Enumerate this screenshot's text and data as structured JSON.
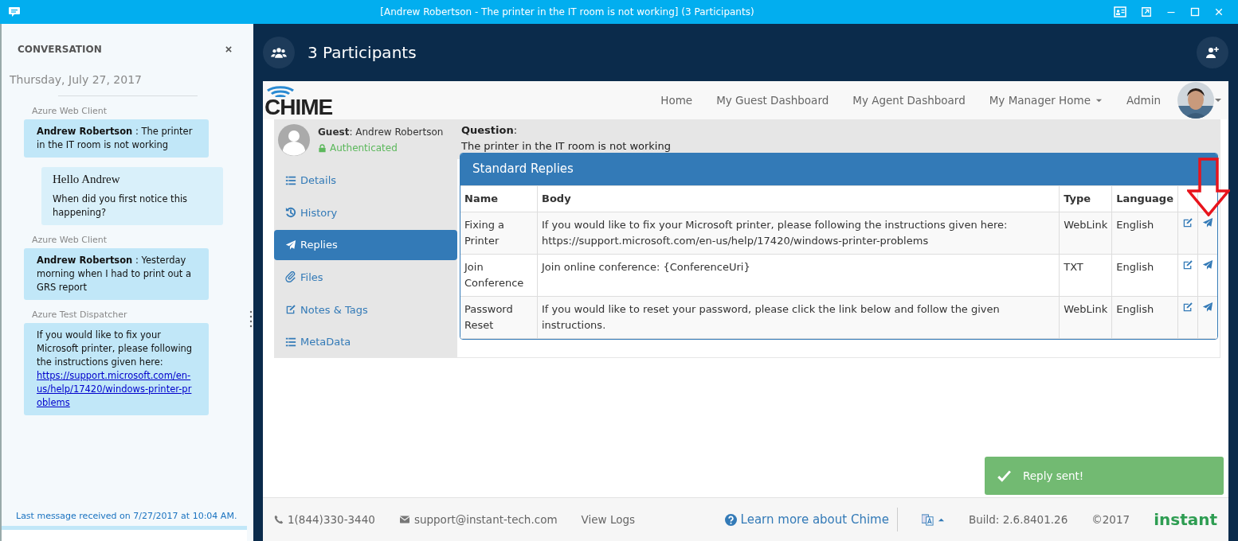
{
  "window": {
    "title": "[Andrew Robertson - The printer in the IT room is not working] (3 Participants)"
  },
  "conversation": {
    "heading": "CONVERSATION",
    "date": "Thursday, July 27, 2017",
    "messages": [
      {
        "kind": "incoming",
        "sender": "Azure Web Client",
        "text": "**Andrew Robertson** : The printer in the IT room is not working"
      },
      {
        "kind": "outgoing",
        "greeting": "Hello Andrew",
        "text": "When did you first notice this happening?"
      },
      {
        "kind": "incoming",
        "sender": "Azure Web Client",
        "text": "**Andrew Robertson** : Yesterday morning when I had to print out a GRS report"
      },
      {
        "kind": "incoming",
        "sender": "Azure Test Dispatcher",
        "text": "If you would like to fix your Microsoft printer, please following the instructions given here:",
        "link": "https://support.microsoft.com/en-us/help/17420/windows-printer-problems"
      }
    ],
    "status": "Last message received on 7/27/2017 at 10:04 AM."
  },
  "header": {
    "title": "3 Participants"
  },
  "navbar": {
    "logo": "CHIME",
    "items": [
      {
        "label": "Home",
        "dropdown": false
      },
      {
        "label": "My Guest Dashboard",
        "dropdown": false
      },
      {
        "label": "My Agent Dashboard",
        "dropdown": false
      },
      {
        "label": "My Manager Home",
        "dropdown": true
      },
      {
        "label": "Admin",
        "dropdown": false
      }
    ]
  },
  "guest": {
    "name": "**Guest**: Andrew Robertson",
    "status": "Authenticated"
  },
  "question": {
    "label": "**Question**:",
    "text": "The printer in the IT room is not working"
  },
  "sidebar": {
    "items": [
      {
        "label": "Details",
        "selected": false
      },
      {
        "label": "History",
        "selected": false
      },
      {
        "label": "Replies",
        "selected": true
      },
      {
        "label": "Files",
        "selected": false
      },
      {
        "label": "Notes & Tags",
        "selected": false
      },
      {
        "label": "MetaData",
        "selected": false
      }
    ]
  },
  "replies": {
    "title": "Standard Replies",
    "columns": [
      "Name",
      "Body",
      "Type",
      "Language"
    ],
    "rows": [
      {
        "name": "Fixing a Printer",
        "body": "If you would like to fix your Microsoft printer, please following the instructions given here: https://support.microsoft.com/en-us/help/17420/windows-printer-problems",
        "type": "WebLink",
        "language": "English"
      },
      {
        "name": "Join Conference",
        "body": "Join online conference: {ConferenceUri}",
        "type": "TXT",
        "language": "English"
      },
      {
        "name": "Password Reset",
        "body": "If you would like to reset your password, please click the link below and follow the given instructions.",
        "type": "WebLink",
        "language": "English"
      }
    ]
  },
  "footer": {
    "phone": "1(844)330-3440",
    "email": "support@instant-tech.com",
    "logs": "View Logs",
    "learn": "Learn more about Chime",
    "build": "Build: 2.6.8401.26",
    "copyright": "©2017",
    "brand": "instant"
  },
  "toast": {
    "text": "Reply sent!"
  }
}
